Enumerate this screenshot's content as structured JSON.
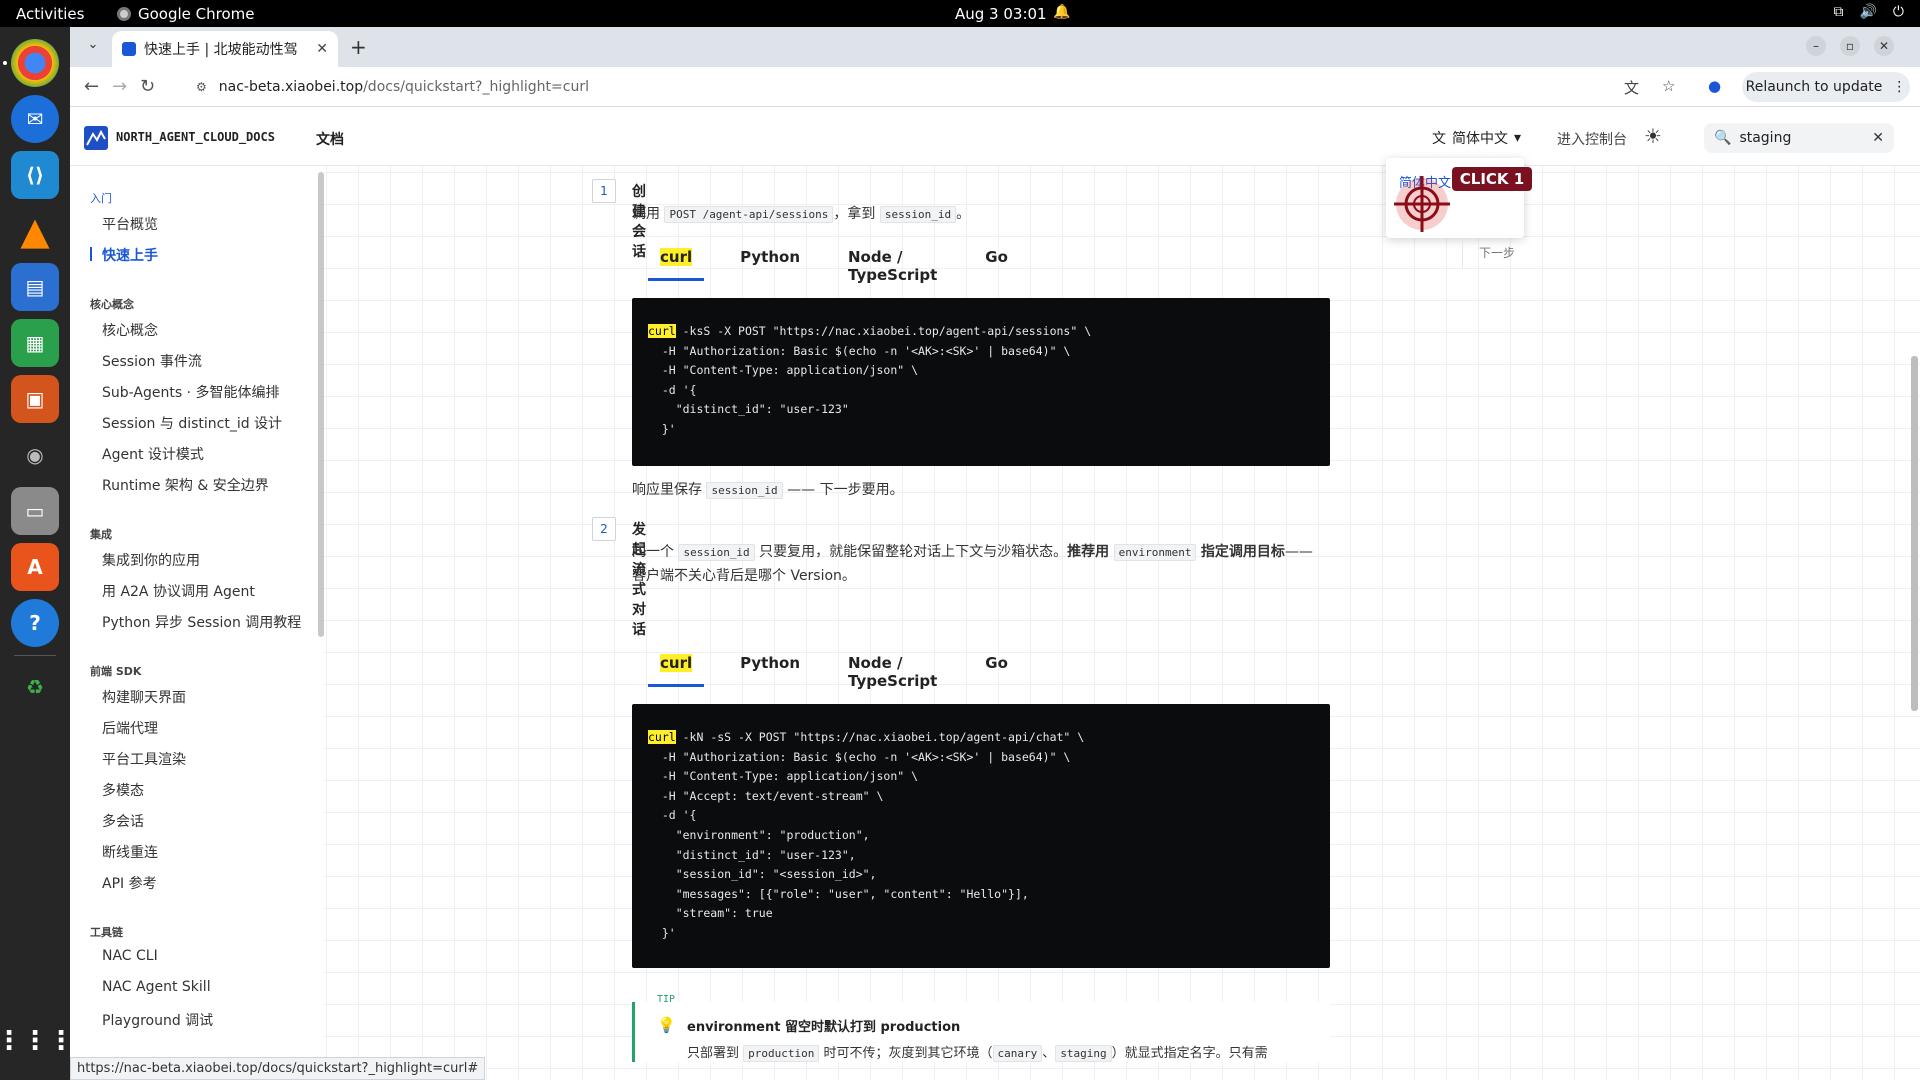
{
  "system": {
    "activities": "Activities",
    "app_name": "Google Chrome",
    "clock": "Aug 3  03:01"
  },
  "browser": {
    "tab_title": "快速上手 | 北坡能动性驾",
    "url_host": "nac-beta.xiaobei.top",
    "url_path": "/docs/quickstart?_highlight=curl",
    "relaunch": "Relaunch to update",
    "status_url": "https://nac-beta.xiaobei.top/docs/quickstart?_highlight=curl#"
  },
  "site": {
    "brand": "NORTH_AGENT_CLOUD_DOCS",
    "docs": "文档",
    "language": "简体中文",
    "console": "进入控制台",
    "search_value": "staging"
  },
  "sidebar": {
    "sections": [
      {
        "title": "入门",
        "items": [
          "平台概览",
          "快速上手"
        ]
      },
      {
        "title": "核心概念",
        "items": [
          "核心概念",
          "Session 事件流",
          "Sub-Agents · 多智能体编排",
          "Session 与 distinct_id 设计",
          "Agent 设计模式",
          "Runtime 架构 & 安全边界"
        ]
      },
      {
        "title": "集成",
        "items": [
          "集成到你的应用",
          "用 A2A 协议调用 Agent",
          "Python 异步 Session 调用教程"
        ]
      },
      {
        "title": "前端 SDK",
        "items": [
          "构建聊天界面",
          "后端代理",
          "平台工具渲染",
          "多模态",
          "多会话",
          "断线重连",
          "API 参考"
        ]
      },
      {
        "title": "工具链",
        "items": [
          "NAC CLI",
          "NAC Agent Skill",
          "Playground 调试"
        ]
      }
    ],
    "active_item": "快速上手"
  },
  "dropdown": {
    "option": "简体中文",
    "click_label": "CLICK 1",
    "next": "下一步"
  },
  "steps": [
    {
      "num": "1",
      "title": "创建会话",
      "desc_a": "调用",
      "desc_code1": "POST /agent-api/sessions",
      "desc_b": "，拿到",
      "desc_code2": "session_id",
      "desc_c": "。",
      "tabs": [
        "curl",
        "Python",
        "Node / TypeScript",
        "Go"
      ],
      "after_a": "响应里保存",
      "after_code": "session_id",
      "after_b": "—— 下一步要用。"
    },
    {
      "num": "2",
      "title": "发起流式对话",
      "desc_a": "同一个",
      "desc_code1": "session_id",
      "desc_b": "只要复用，就能保留整轮对话上下文与沙箱状态。",
      "desc_bold1": "推荐用",
      "desc_code2": "environment",
      "desc_bold2": "指定调用目标",
      "desc_c": "——",
      "desc_line2": "客户端不关心背后是哪个 Version。",
      "tabs": [
        "curl",
        "Python",
        "Node / TypeScript",
        "Go"
      ]
    }
  ],
  "tip": {
    "label": "TIP",
    "title": "environment 留空时默认打到 production",
    "body_a": "只部署到",
    "body_code1": "production",
    "body_b": "时可不传；灰度到其它环境（",
    "body_code2": "canary",
    "body_c": "、",
    "body_code3": "staging",
    "body_d": "）就显式指定名字。只有需"
  },
  "code1": [
    "curl -ksS -X POST \"https://nac.xiaobei.top/agent-api/sessions\" \\",
    "  -H \"Authorization: Basic $(echo -n '<AK>:<SK>' | base64)\" \\",
    "  -H \"Content-Type: application/json\" \\",
    "  -d '{",
    "    \"distinct_id\": \"user-123\"",
    "  }'"
  ],
  "code2": [
    "curl -kN -sS -X POST \"https://nac.xiaobei.top/agent-api/chat\" \\",
    "  -H \"Authorization: Basic $(echo -n '<AK>:<SK>' | base64)\" \\",
    "  -H \"Content-Type: application/json\" \\",
    "  -H \"Accept: text/event-stream\" \\",
    "  -d '{",
    "    \"environment\": \"production\",",
    "    \"distinct_id\": \"user-123\",",
    "    \"session_id\": \"<session_id>\",",
    "    \"messages\": [{\"role\": \"user\", \"content\": \"Hello\"}],",
    "    \"stream\": true",
    "  }'"
  ],
  "colors": {
    "accent": "#1a57d6",
    "highlight": "#ffef2a",
    "tip": "#23a466",
    "badge": "#7a1120"
  }
}
